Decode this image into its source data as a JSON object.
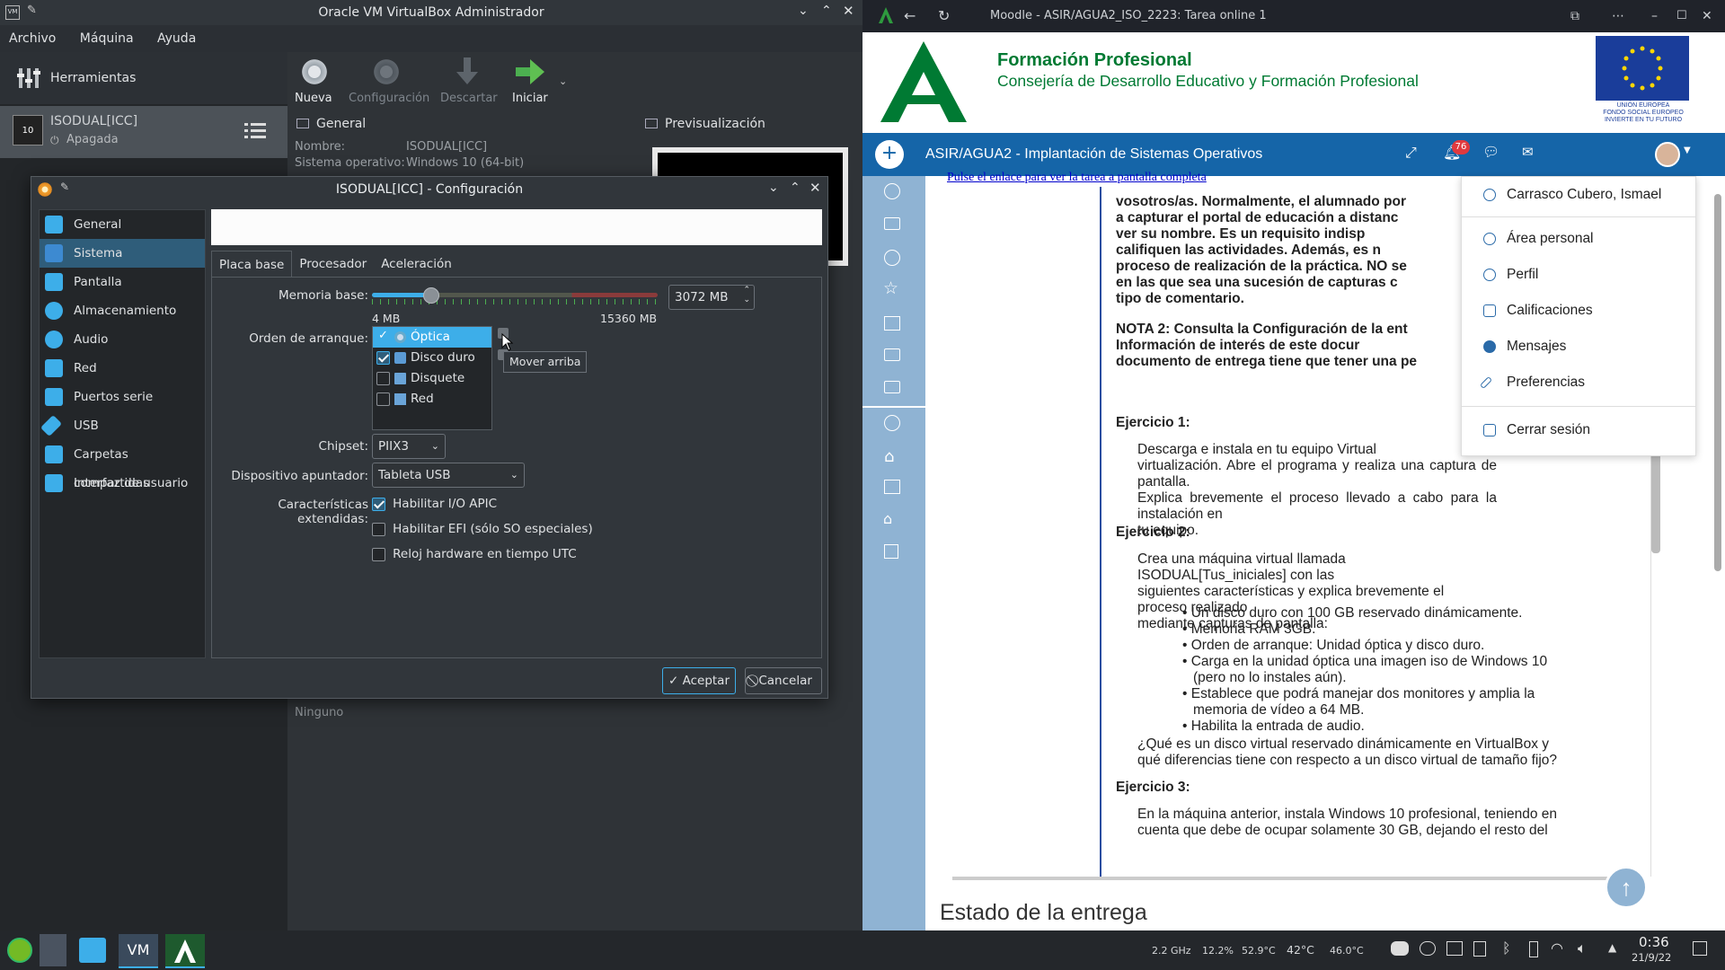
{
  "vbox": {
    "title": "Oracle VM VirtualBox Administrador",
    "menu": [
      "Archivo",
      "Máquina",
      "Ayuda"
    ],
    "tools_label": "Herramientas",
    "vm_name": "ISODUAL[ICC]",
    "vm_state": "Apagada",
    "toolbar": {
      "new": "Nueva",
      "settings": "Configuración",
      "discard": "Descartar",
      "start": "Iniciar"
    },
    "general": {
      "header": "General",
      "name_label": "Nombre:",
      "name_value": "ISODUAL[ICC]",
      "os_label": "Sistema operativo:",
      "os_value": "Windows 10 (64-bit)"
    },
    "preview_header": "Previsualización",
    "none_label": "Ninguno"
  },
  "dialog": {
    "title": "ISODUAL[ICC] - Configuración",
    "nav": [
      {
        "label": "General",
        "icon": "general-icon",
        "color": "#3daee9"
      },
      {
        "label": "Sistema",
        "icon": "system-icon",
        "color": "#3daee9"
      },
      {
        "label": "Pantalla",
        "icon": "display-icon",
        "color": "#3daee9"
      },
      {
        "label": "Almacenamiento",
        "icon": "storage-icon",
        "color": "#3daee9"
      },
      {
        "label": "Audio",
        "icon": "audio-icon",
        "color": "#3daee9"
      },
      {
        "label": "Red",
        "icon": "network-icon",
        "color": "#3daee9"
      },
      {
        "label": "Puertos serie",
        "icon": "serial-port-icon",
        "color": "#3daee9"
      },
      {
        "label": "USB",
        "icon": "usb-icon",
        "color": "#3daee9"
      },
      {
        "label": "Carpetas compartidas",
        "icon": "shared-folder-icon",
        "color": "#3daee9"
      },
      {
        "label": "Interfaz de usuario",
        "icon": "user-interface-icon",
        "color": "#3daee9"
      }
    ],
    "selected_nav": "Sistema",
    "tabs": [
      "Placa base",
      "Procesador",
      "Aceleración"
    ],
    "memory": {
      "label": "Memoria base:",
      "value": "3072 MB",
      "min": "4 MB",
      "max": "15360 MB",
      "fraction": 0.2
    },
    "boot": {
      "label": "Orden de arranque:",
      "items": [
        {
          "label": "Óptica",
          "checked": true
        },
        {
          "label": "Disco duro",
          "checked": true
        },
        {
          "label": "Disquete",
          "checked": false
        },
        {
          "label": "Red",
          "checked": false
        }
      ],
      "tooltip": "Mover arriba"
    },
    "chipset": {
      "label": "Chipset:",
      "value": "PIIX3"
    },
    "pointer": {
      "label": "Dispositivo apuntador:",
      "value": "Tableta USB"
    },
    "ext": {
      "label": "Características extendidas:",
      "options": [
        {
          "label": "Habilitar I/O APIC",
          "checked": true
        },
        {
          "label": "Habilitar EFI (sólo SO especiales)",
          "checked": false
        },
        {
          "label": "Reloj hardware en tiempo UTC",
          "checked": false
        }
      ]
    },
    "ok": "Aceptar",
    "cancel": "Cancelar"
  },
  "browser": {
    "title": "Moodle - ASIR/AGUA2_ISO_2223: Tarea online 1",
    "brand_title": "Formación Profesional",
    "brand_sub": "Consejería de Desarrollo Educativo y Formación Profesional",
    "eu_text": "UNIÓN EUROPEA\nFONDO SOCIAL EUROPEO\nINVIERTE EN TU FUTURO",
    "course": "ASIR/AGUA2 - Implantación de Sistemas Operativos",
    "notif_count": "76",
    "link_text": "Pulse el enlace para ver la tarea a pantalla completa",
    "para1": "vosotros/as. Normalmente, el alumnado por a capturar el portal de educación a distanc ver su nombre. Es un requisito indisp califiquen las actividades. Además, es n proceso de realización de la práctica. NO se en las que sea una sucesión de capturas c tipo de comentario.",
    "para1_lines": [
      "vosotros/as.  Normalmente, el alumnado por",
      "a capturar el portal de educación a distanc",
      "ver su nombre.  Es un requisito indisp",
      "califiquen las actividades. Además, es n",
      "proceso de realización de la práctica. NO se",
      "en las que sea una sucesión de capturas c",
      "tipo de comentario."
    ],
    "nota2_lines": [
      "NOTA 2: Consulta la Configuración de la ent",
      "Información de interés de este docur",
      "documento de entrega tiene que tener una pe"
    ],
    "ej1_title": "Ejercicio 1:",
    "ej1_lines": [
      "Descarga e instala en tu equipo Virtual",
      "virtualización. Abre el programa y realiza una captura de pantalla.",
      "Explica brevemente el proceso llevado a cabo para la instalación en",
      "tu equipo."
    ],
    "ej2_title": "Ejercicio 2:",
    "ej2_lines": [
      "Crea una máquina virtual llamada ISODUAL[Tus_iniciales] con las",
      "siguientes características y explica brevemente el proceso realizado",
      "mediante capturas de pantalla:"
    ],
    "ej2_bullets": [
      "Un disco duro con 100 GB reservado dinámicamente.",
      "Memoria RAM 3GB.",
      "Orden de arranque: Unidad óptica y disco duro.",
      "Carga en la unidad óptica una imagen iso de Windows 10",
      "(pero no lo instales aún).",
      "Establece que podrá manejar dos monitores y amplia la",
      "memoria de vídeo a 64 MB.",
      "Habilita la entrada de audio."
    ],
    "ej2_q_lines": [
      "¿Qué es un disco virtual reservado dinámicamente en VirtualBox y",
      "qué diferencias tiene con respecto a un disco virtual de tamaño fijo?"
    ],
    "ej3_title": "Ejercicio 3:",
    "ej3_lines": [
      "En la máquina anterior, instala Windows 10 profesional, teniendo en",
      "cuenta que debe de ocupar solamente 30 GB, dejando el resto del"
    ],
    "status_heading": "Estado de la entrega",
    "user_menu": [
      {
        "label": "Carrasco Cubero, Ismael",
        "icon": "user-icon"
      },
      {
        "label": "Área personal",
        "icon": "dashboard-icon"
      },
      {
        "label": "Perfil",
        "icon": "profile-icon"
      },
      {
        "label": "Calificaciones",
        "icon": "grades-icon"
      },
      {
        "label": "Mensajes",
        "icon": "messages-icon"
      },
      {
        "label": "Preferencias",
        "icon": "wrench-icon"
      },
      {
        "label": "Cerrar sesión",
        "icon": "logout-icon"
      }
    ]
  },
  "taskbar": {
    "cpu_freq": "2.2 GHz",
    "cpu_load": "12.2%",
    "temp1": "52.9°C",
    "temp2": "42°C",
    "temp3": "46.0°C",
    "time": "0:36",
    "date": "21/9/22"
  },
  "colors": {
    "accent": "#3daee9",
    "moodle_blue": "#1565a8",
    "green": "#007a33"
  }
}
